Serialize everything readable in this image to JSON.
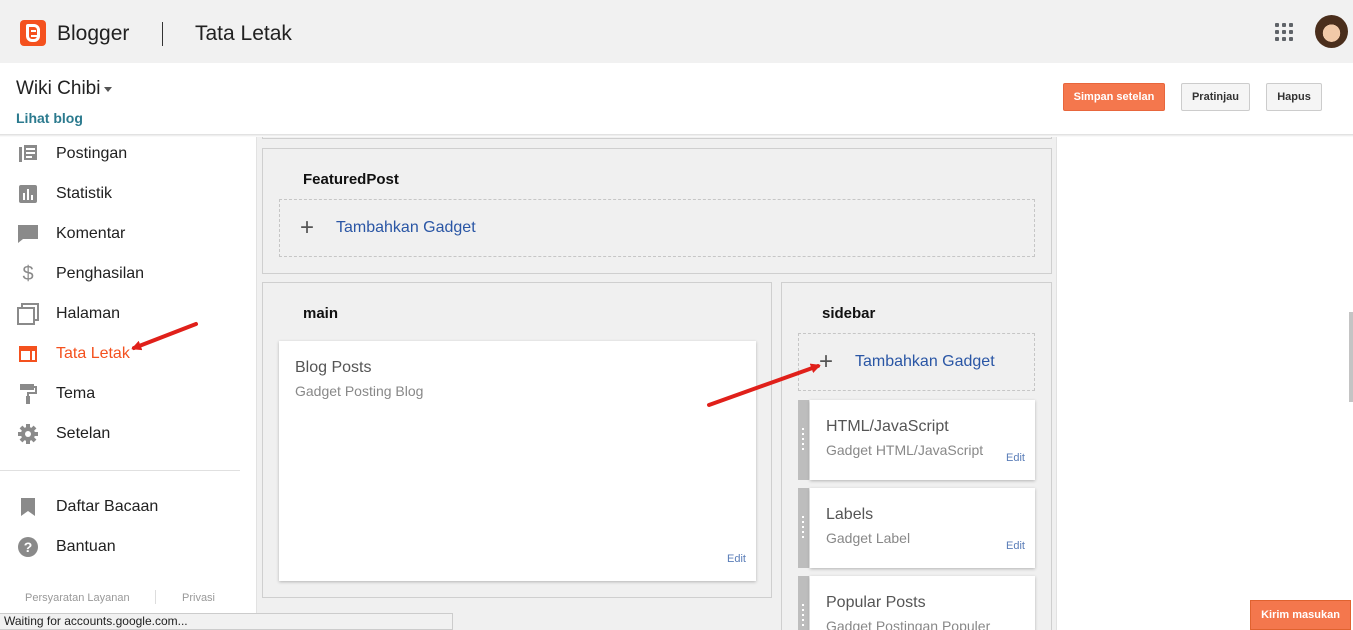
{
  "topbar": {
    "brand": "Blogger",
    "page_heading": "Tata Letak"
  },
  "header": {
    "blog_title": "Wiki Chibi",
    "view_blog": "Lihat blog",
    "save_label": "Simpan setelan",
    "preview_label": "Pratinjau",
    "delete_label": "Hapus"
  },
  "nav": {
    "items": [
      {
        "label": "Postingan",
        "icon": "posts-icon"
      },
      {
        "label": "Statistik",
        "icon": "stats-icon"
      },
      {
        "label": "Komentar",
        "icon": "comment-icon"
      },
      {
        "label": "Penghasilan",
        "icon": "dollar-icon"
      },
      {
        "label": "Halaman",
        "icon": "pages-icon"
      },
      {
        "label": "Tata Letak",
        "icon": "layout-icon",
        "active": true
      },
      {
        "label": "Tema",
        "icon": "paint-roller-icon"
      },
      {
        "label": "Setelan",
        "icon": "gear-icon"
      }
    ],
    "secondary": [
      {
        "label": "Daftar Bacaan",
        "icon": "bookmark-icon"
      },
      {
        "label": "Bantuan",
        "icon": "help-icon"
      }
    ],
    "footer_terms": "Persyaratan Layanan",
    "footer_privacy": "Privasi"
  },
  "layout": {
    "featured": {
      "title": "FeaturedPost",
      "add_gadget": "Tambahkan Gadget"
    },
    "main": {
      "title": "main",
      "gadgets": [
        {
          "title": "Blog Posts",
          "subtitle": "Gadget Posting Blog",
          "edit": "Edit"
        }
      ]
    },
    "sidebar": {
      "title": "sidebar",
      "add_gadget": "Tambahkan Gadget",
      "gadgets": [
        {
          "title": "HTML/JavaScript",
          "subtitle": "Gadget HTML/JavaScript",
          "edit": "Edit"
        },
        {
          "title": "Labels",
          "subtitle": "Gadget Label",
          "edit": "Edit"
        },
        {
          "title": "Popular Posts",
          "subtitle": "Gadget Postingan Populer"
        }
      ]
    }
  },
  "status_text": "Waiting for accounts.google.com...",
  "feedback_label": "Kirim masukan",
  "colors": {
    "accent": "#f4511e",
    "button_orange": "#f4774d",
    "link_blue": "#2a56a5",
    "annotation_red": "#e0201a"
  }
}
